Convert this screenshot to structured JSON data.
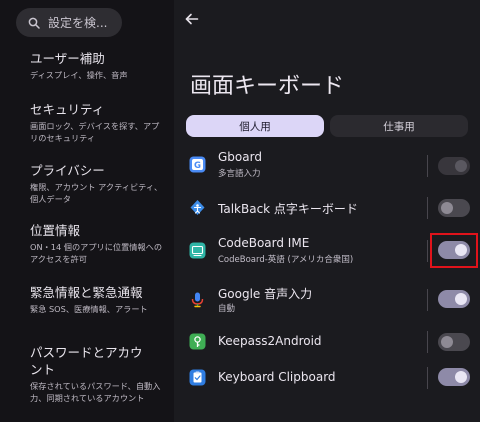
{
  "search": {
    "placeholder": "設定を検..."
  },
  "categories": [
    {
      "title": "ユーザー補助",
      "subtitle": "ディスプレイ、操作、音声"
    },
    {
      "title": "セキュリティ",
      "subtitle": "画面ロック、デバイスを探す、アプリのセキュリティ"
    },
    {
      "title": "プライバシー",
      "subtitle": "権限、アカウント アクティビティ、個人データ"
    },
    {
      "title": "位置情報",
      "subtitle": "ON・14 個のアプリに位置情報へのアクセスを許可"
    },
    {
      "title": "緊急情報と緊急通報",
      "subtitle": "緊急 SOS、医療情報、アラート"
    },
    {
      "title": "パスワードとアカウント",
      "subtitle": "保存されているパスワード、自動入力、同期されているアカウント"
    }
  ],
  "page": {
    "title": "画面キーボード"
  },
  "tabs": [
    {
      "label": "個人用",
      "active": true
    },
    {
      "label": "仕事用",
      "active": false
    }
  ],
  "keyboards": [
    {
      "name": "Gboard",
      "subtitle": "多言語入力",
      "icon": "gboard-icon",
      "enabled": true,
      "disabled": true
    },
    {
      "name": "TalkBack 点字キーボード",
      "subtitle": "",
      "icon": "talkback-braille-icon",
      "enabled": false
    },
    {
      "name": "CodeBoard IME",
      "subtitle": "CodeBoard-英語 (アメリカ合衆国)",
      "icon": "codeboard-icon",
      "enabled": true
    },
    {
      "name": "Google 音声入力",
      "subtitle": "自動",
      "icon": "google-voice-icon",
      "enabled": true
    },
    {
      "name": "Keepass2Android",
      "subtitle": "",
      "icon": "keepass-icon",
      "enabled": false
    },
    {
      "name": "Keyboard Clipboard",
      "subtitle": "",
      "icon": "keyboard-clipboard-icon",
      "enabled": true
    }
  ],
  "colors": {
    "accent": "#dcd6f7",
    "highlight": "#e0131b",
    "toggle_on": "#8e8aa8"
  }
}
